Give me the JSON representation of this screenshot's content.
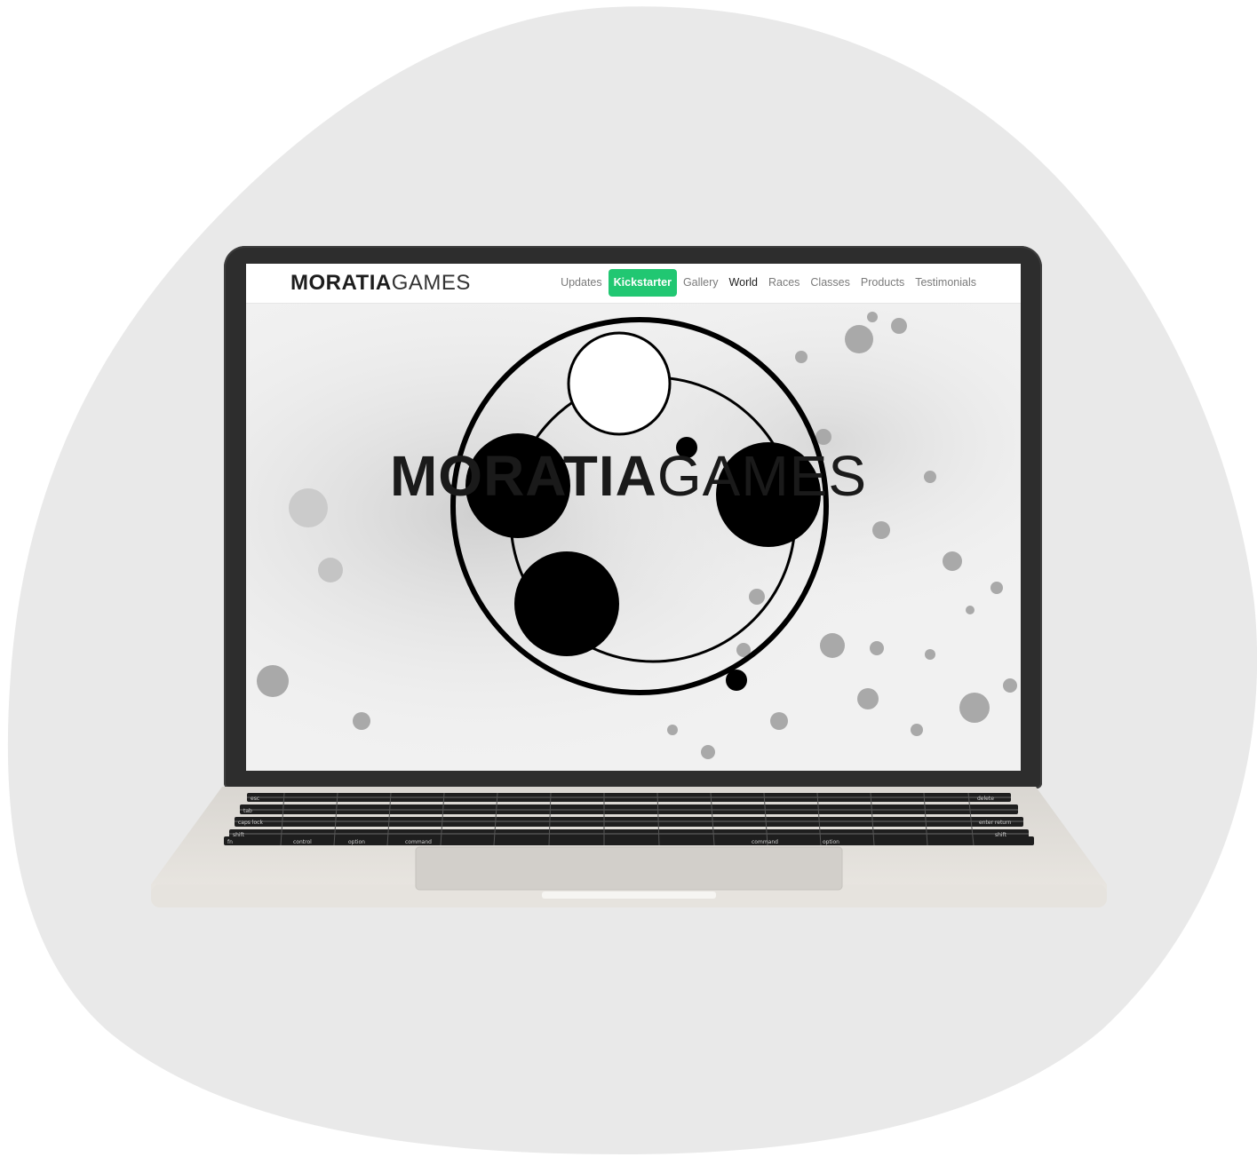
{
  "site": {
    "brand_bold": "MORATIA",
    "brand_light": "GAMES"
  },
  "nav": {
    "items": [
      {
        "label": "Updates",
        "state": "default"
      },
      {
        "label": "Kickstarter",
        "state": "cta"
      },
      {
        "label": "Gallery",
        "state": "default"
      },
      {
        "label": "World",
        "state": "active"
      },
      {
        "label": "Races",
        "state": "default"
      },
      {
        "label": "Classes",
        "state": "default"
      },
      {
        "label": "Products",
        "state": "default"
      },
      {
        "label": "Testimonials",
        "state": "default"
      }
    ]
  },
  "hero": {
    "title_bold": "MORATIA",
    "title_light": "GAMES"
  },
  "keyboard": {
    "labels": [
      "esc",
      "delete",
      "tab",
      "caps lock",
      "enter return",
      "shift",
      "shift",
      "fn",
      "control",
      "option",
      "command",
      "command",
      "option"
    ]
  },
  "colors": {
    "accent_cta": "#21c772",
    "background_blob": "#e9e9e9",
    "laptop_body": "#e4e1dc",
    "bezel": "#2d2d2d"
  }
}
